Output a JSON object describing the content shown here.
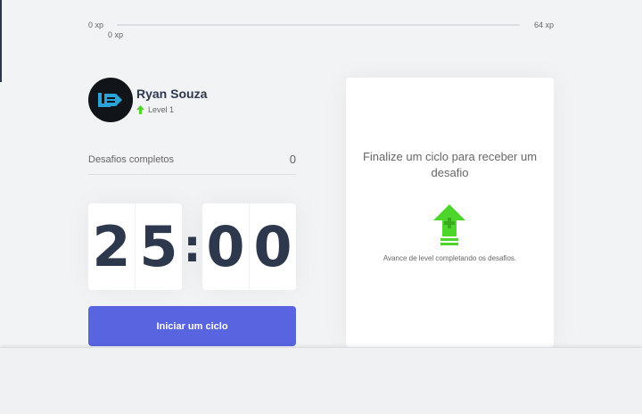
{
  "xp": {
    "min_label": "0 xp",
    "max_label": "64 xp",
    "current_label": "0 xp",
    "progress_fraction": 0
  },
  "profile": {
    "name": "Ryan Souza",
    "level_label": "Level 1",
    "avatar_icon": "logo-avatar-icon",
    "level_icon": "level-up-arrow-icon"
  },
  "stats": {
    "completed_label": "Desafios completos",
    "completed_value": "0"
  },
  "countdown": {
    "minute_left": "2",
    "minute_right": "5",
    "separator": ":",
    "second_left": "0",
    "second_right": "0"
  },
  "actions": {
    "start_label": "Iniciar um ciclo"
  },
  "challenge": {
    "title": "Finalize um ciclo para receber um desafio",
    "hint": "Avance de level completando os desafios.",
    "icon": "level-up-icon"
  },
  "colors": {
    "accent": "#5965e0",
    "green": "#4cd62b",
    "title": "#2e384d",
    "text": "#666666",
    "background": "#f2f3f5"
  }
}
